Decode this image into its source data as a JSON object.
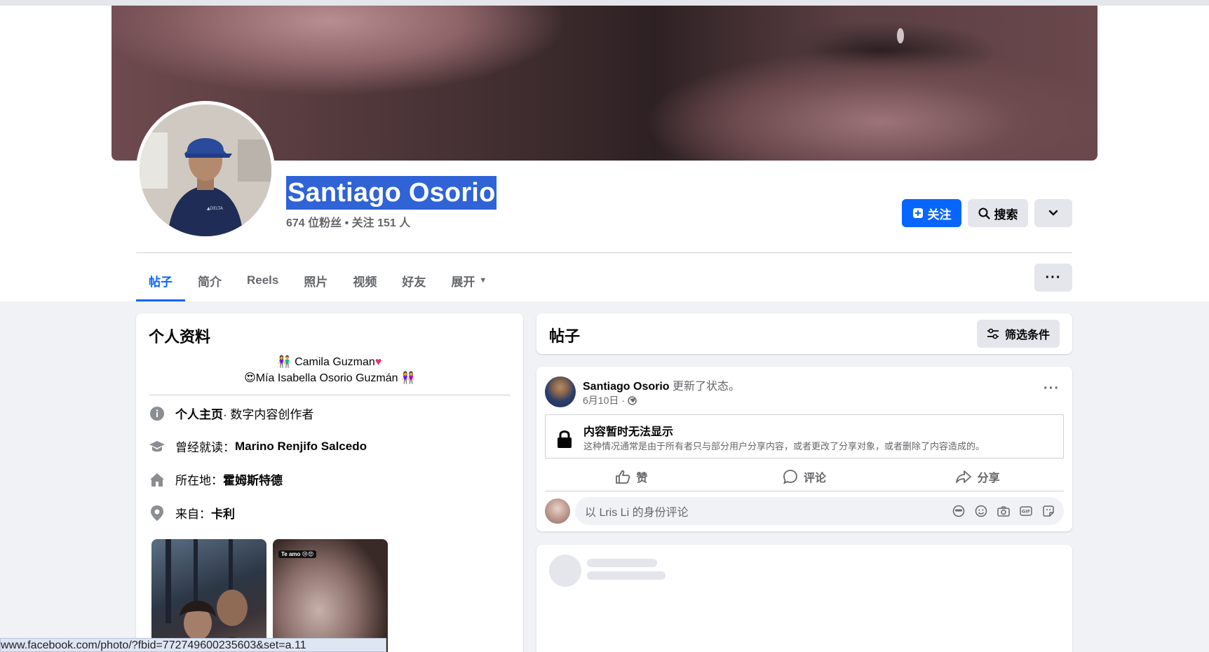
{
  "profile": {
    "name": "Santiago Osorio",
    "stats": "674 位粉丝 • 关注 151 人"
  },
  "actions": {
    "follow_label": "关注",
    "search_label": "搜索"
  },
  "tabs": [
    {
      "label": "帖子",
      "active": true
    },
    {
      "label": "简介"
    },
    {
      "label": "Reels"
    },
    {
      "label": "照片"
    },
    {
      "label": "视频"
    },
    {
      "label": "好友"
    },
    {
      "label": "展开"
    }
  ],
  "intro": {
    "title": "个人资料",
    "bio_line1": "Camila Guzman",
    "bio_line2": "Mía Isabella Osorio Guzmán",
    "rows": [
      {
        "icon": "info-icon",
        "label": "个人主页",
        "value": " · 数字内容创作者"
      },
      {
        "icon": "graduation-cap-icon",
        "label": "曾经就读：",
        "value": "Marino Renjifo Salcedo"
      },
      {
        "icon": "home-icon",
        "label": "所在地：",
        "value": "霍姆斯特德"
      },
      {
        "icon": "location-pin-icon",
        "label": "来自：",
        "value": "卡利"
      }
    ],
    "photo_tag": "Te amo"
  },
  "posts": {
    "title": "帖子",
    "filter_label": "筛选条件",
    "post": {
      "author": "Santiago Osorio",
      "action": " 更新了状态。",
      "date": "6月10日 ·",
      "notice_title": "内容暂时无法显示",
      "notice_desc": "这种情况通常是由于所有者只与部分用户分享内容，或者更改了分享对象，或者删除了内容造成的。",
      "like_label": "赞",
      "comment_label": "评论",
      "share_label": "分享",
      "comment_placeholder": "以 Lris Li 的身份评论"
    }
  },
  "status_bar": {
    "url": "www.facebook.com/photo/?fbid=772749600235603&set=a.11"
  },
  "colors": {
    "accent": "#0866ff",
    "name_highlight": "#2f63d6",
    "page_bg": "#f0f2f5"
  }
}
